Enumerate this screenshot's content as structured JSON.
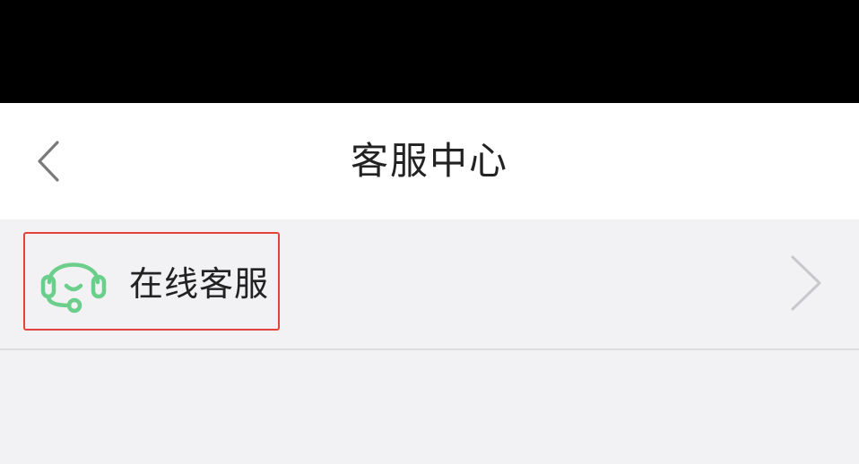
{
  "nav": {
    "title": "客服中心",
    "back_icon": "chevron-left-icon"
  },
  "menu": {
    "items": [
      {
        "label": "在线客服",
        "icon": "headset-icon",
        "trailing_icon": "chevron-right-icon",
        "highlighted": true
      }
    ]
  },
  "colors": {
    "icon_green": "#6bcf8b",
    "highlight_border": "#e0443a",
    "background": "#f2f1f4",
    "nav_background": "#ffffff",
    "status_bar": "#000000"
  }
}
